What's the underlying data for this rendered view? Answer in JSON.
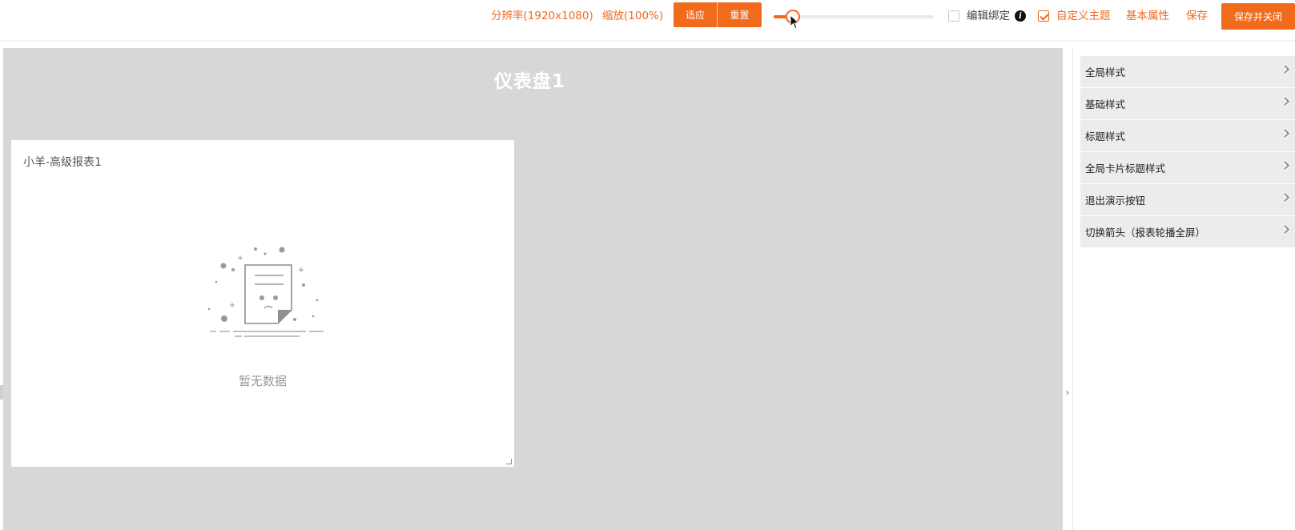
{
  "toolbar": {
    "resolution": "分辨率(1920x1080)",
    "zoom": "缩放(100%)",
    "fit_label": "适应",
    "reset_label": "重置",
    "slider_value": 0.12,
    "edit_binding_label": "编辑绑定",
    "edit_binding_checked": false,
    "custom_theme_label": "自定义主题",
    "custom_theme_checked": true,
    "basic_props_label": "基本属性",
    "save_label": "保存",
    "save_close_label": "保存并关闭"
  },
  "canvas": {
    "dashboard_title": "仪表盘1",
    "card": {
      "title": "小羊-高级报表1",
      "empty_text": "暂无数据"
    }
  },
  "panel": {
    "items": [
      {
        "label": "全局样式"
      },
      {
        "label": "基础样式"
      },
      {
        "label": "标题样式"
      },
      {
        "label": "全局卡片标题样式"
      },
      {
        "label": "退出演示按钮"
      },
      {
        "label": "切换箭头（报表轮播全屏）"
      }
    ]
  },
  "colors": {
    "accent": "#f26a1b",
    "canvas_bg": "#d7d7d7",
    "panel_item_bg": "#ececec"
  }
}
